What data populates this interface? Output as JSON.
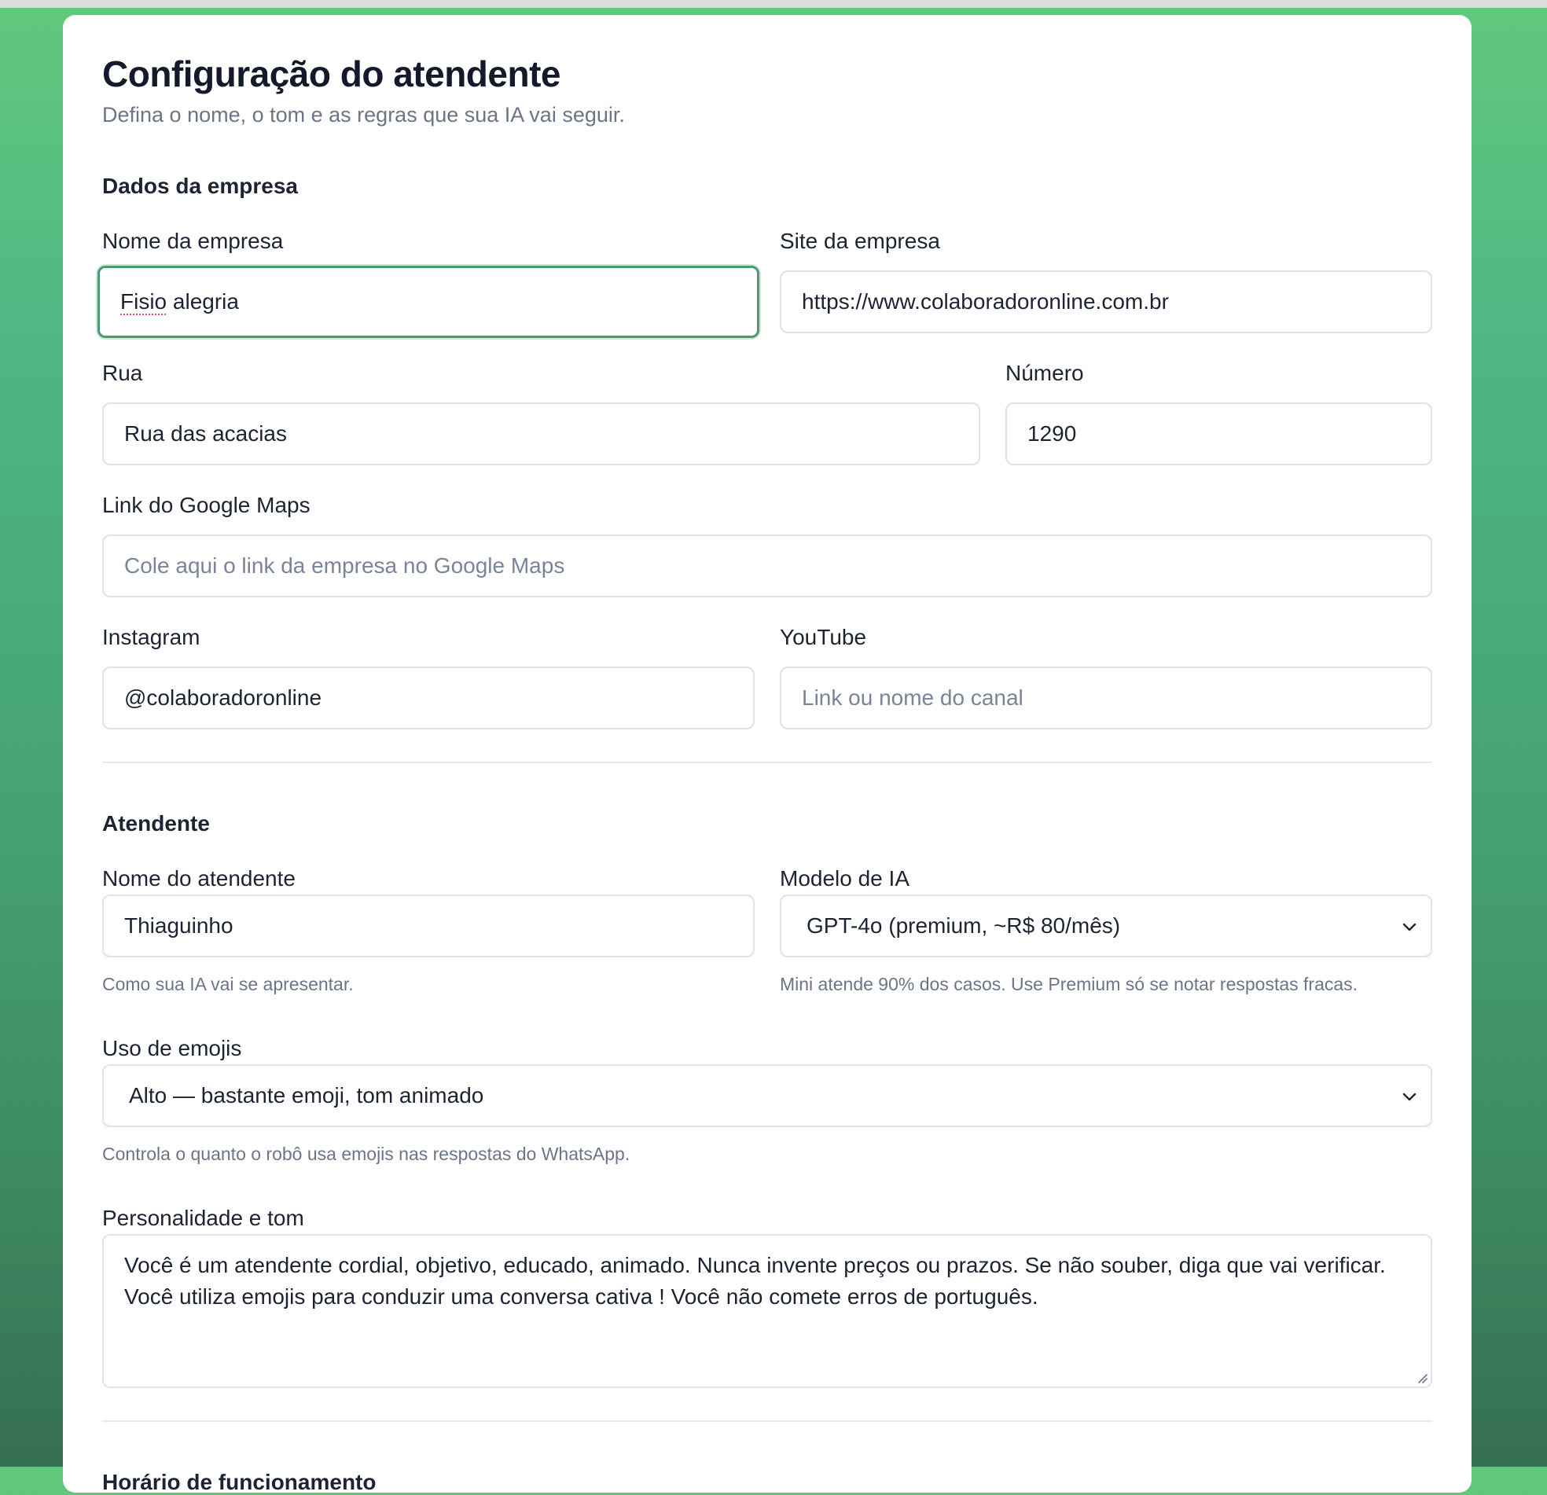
{
  "page": {
    "title": "Configuração do atendente",
    "subtitle": "Defina o nome, o tom e as regras que sua IA vai seguir."
  },
  "company": {
    "section_title": "Dados da empresa",
    "name": {
      "label": "Nome da empresa",
      "value_misspelled": "Fisio",
      "value_rest": " alegria"
    },
    "site": {
      "label": "Site da empresa",
      "value": "https://www.colaboradoronline.com.br"
    },
    "street": {
      "label": "Rua",
      "value": "Rua das acacias"
    },
    "number": {
      "label": "Número",
      "value": "1290"
    },
    "maps": {
      "label": "Link do Google Maps",
      "placeholder": "Cole aqui o link da empresa no Google Maps"
    },
    "instagram": {
      "label": "Instagram",
      "value": "@colaboradoronline"
    },
    "youtube": {
      "label": "YouTube",
      "placeholder": "Link ou nome do canal"
    }
  },
  "attendant": {
    "section_title": "Atendente",
    "name": {
      "label": "Nome do atendente",
      "value": "Thiaguinho",
      "hint": "Como sua IA vai se apresentar."
    },
    "model": {
      "label": "Modelo de IA",
      "selected": "GPT-4o (premium, ~R$ 80/mês)",
      "hint": "Mini atende 90% dos casos. Use Premium só se notar respostas fracas."
    },
    "emoji": {
      "label": "Uso de emojis",
      "selected": "Alto — bastante emoji, tom animado",
      "hint": "Controla o quanto o robô usa emojis nas respostas do WhatsApp."
    },
    "personality": {
      "label": "Personalidade e tom",
      "value": "Você é um atendente cordial, objetivo, educado, animado. Nunca invente preços ou prazos. Se não souber, diga que vai verificar. Você utiliza emojis para conduzir uma conversa cativa ! Você não comete erros de português."
    }
  },
  "hours": {
    "section_title": "Horário de funcionamento"
  },
  "icons": {
    "select_arrow": "chevron-down-icon",
    "resize": "resize-handle-icon"
  },
  "colors": {
    "accent": "#4a9a72",
    "background_top": "#62c87c",
    "background_bottom": "#356f50"
  }
}
